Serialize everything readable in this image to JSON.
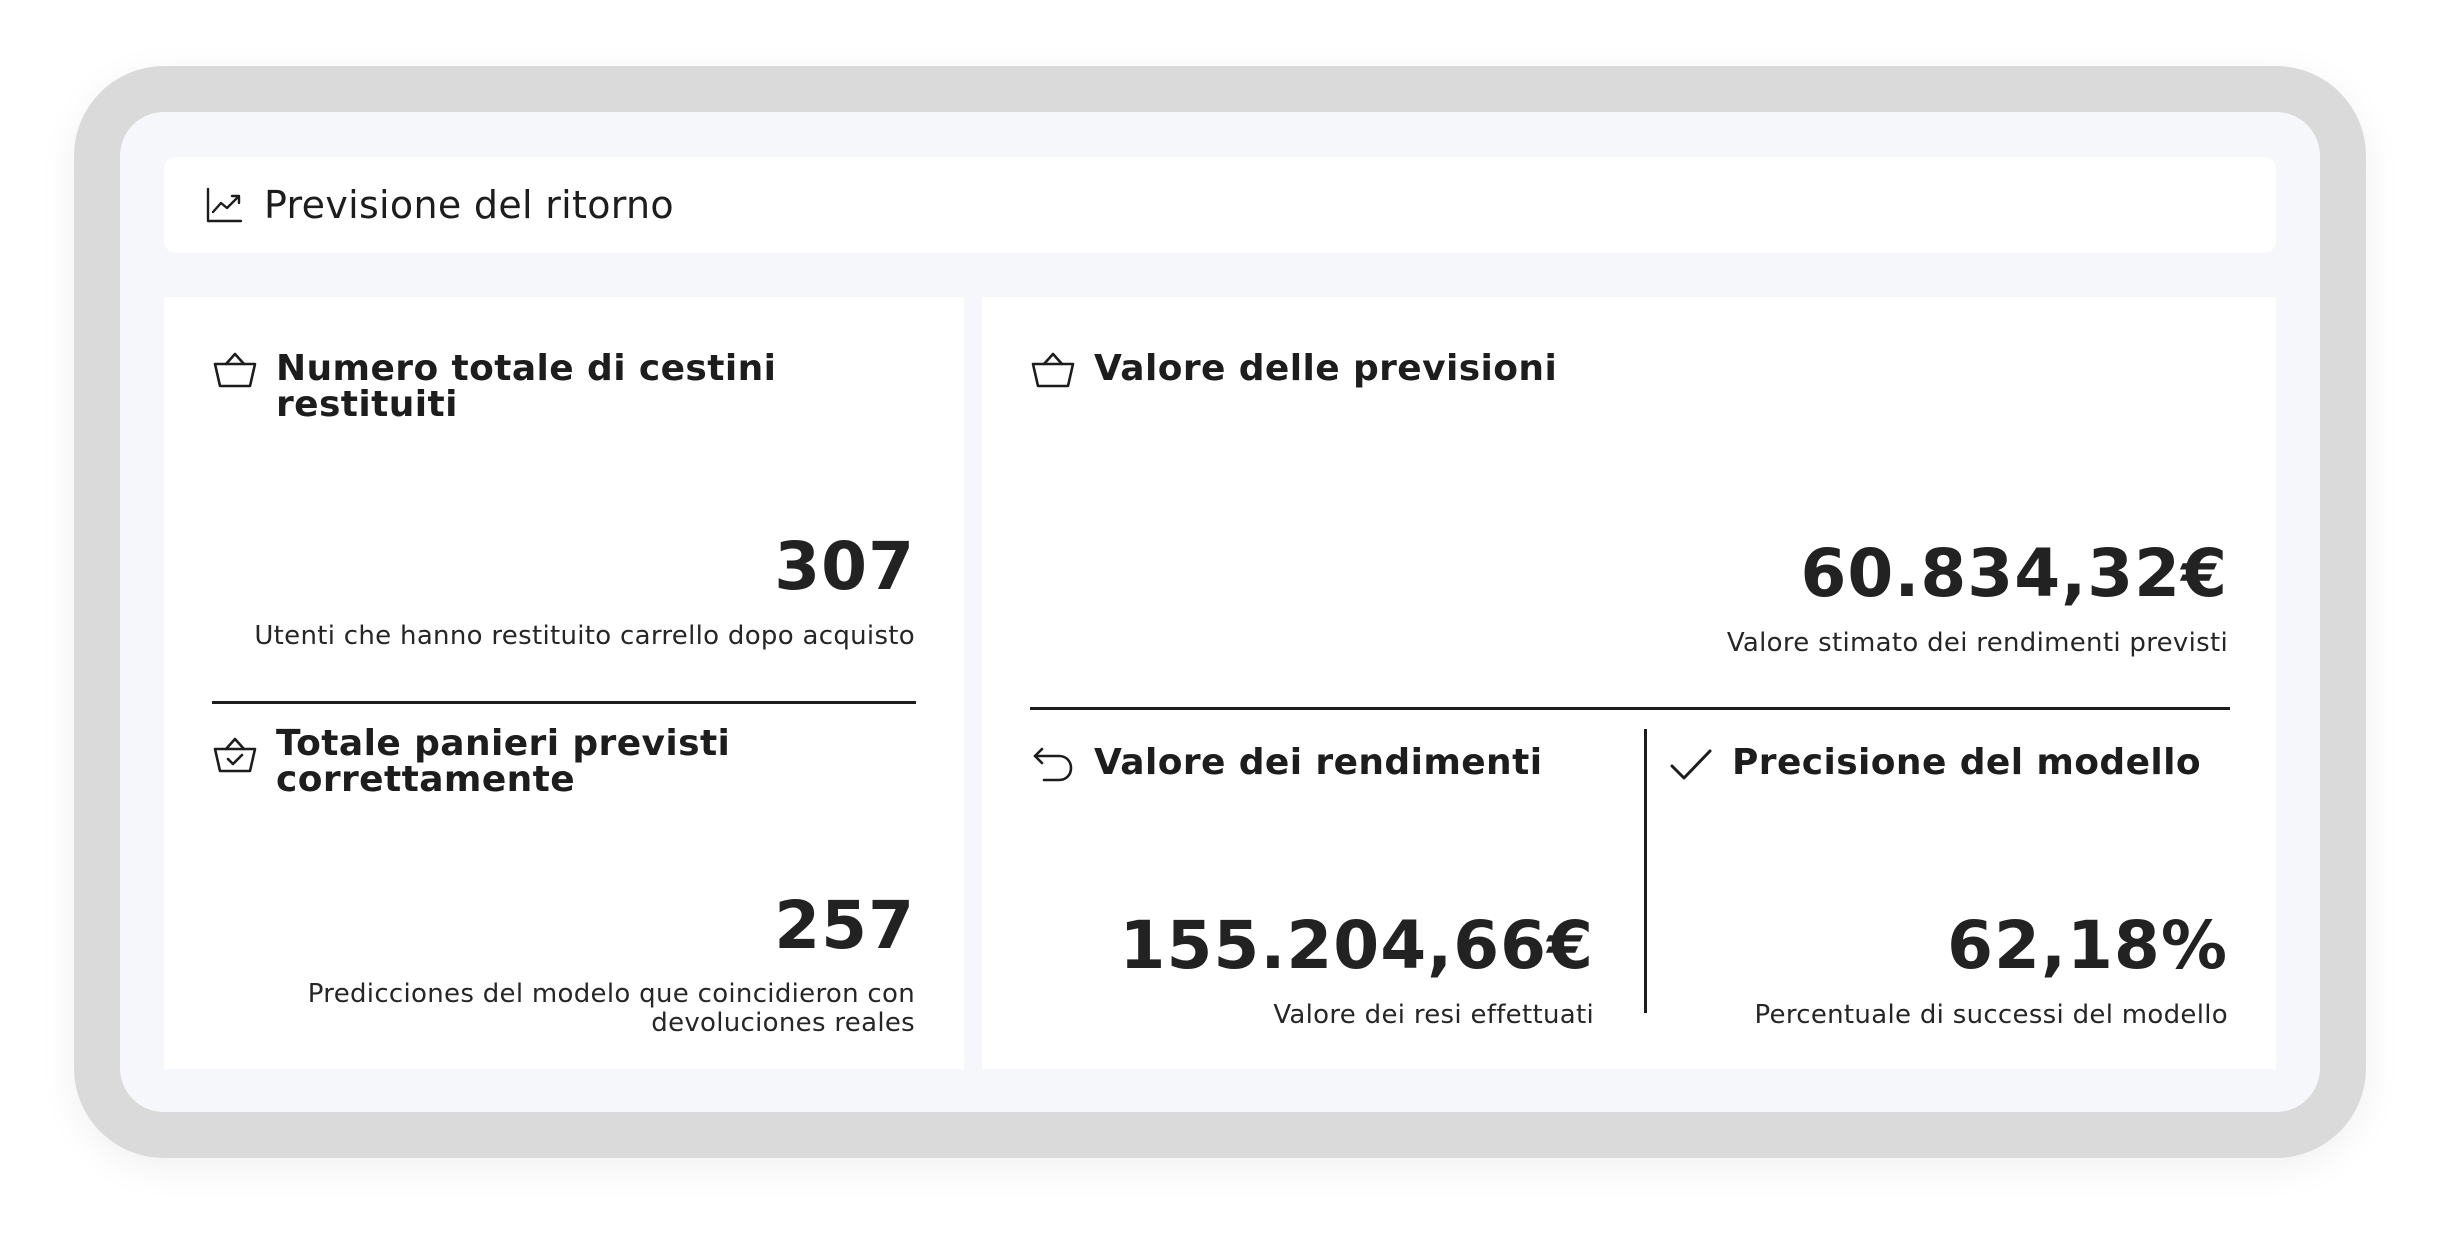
{
  "header": {
    "title": "Previsione del ritorno",
    "icon": "trend-chart-icon"
  },
  "left": {
    "returned_baskets": {
      "title": "Numero totale di cestini restituiti",
      "icon": "basket-icon",
      "value": "307",
      "caption": "Utenti che hanno restituito carrello dopo acquisto"
    },
    "correct_predictions": {
      "title_line1": "Totale panieri previsti",
      "title_line2": "correttamente",
      "icon": "basket-check-icon",
      "value": "257",
      "caption_line1": "Predicciones del modelo que coincidieron con",
      "caption_line2": "devoluciones reales"
    }
  },
  "right": {
    "forecast_value": {
      "title": "Valore delle previsioni",
      "icon": "basket-icon",
      "value": "60.834,32€",
      "caption": "Valore stimato dei rendimenti previsti"
    },
    "returns_value": {
      "title": "Valore dei rendimenti",
      "icon": "undo-arrow-icon",
      "value": "155.204,66€",
      "caption": "Valore dei resi effettuati"
    },
    "model_accuracy": {
      "title": "Precisione del modello",
      "icon": "check-icon",
      "value": "62,18%",
      "caption": "Percentuale di successi del modello"
    }
  }
}
